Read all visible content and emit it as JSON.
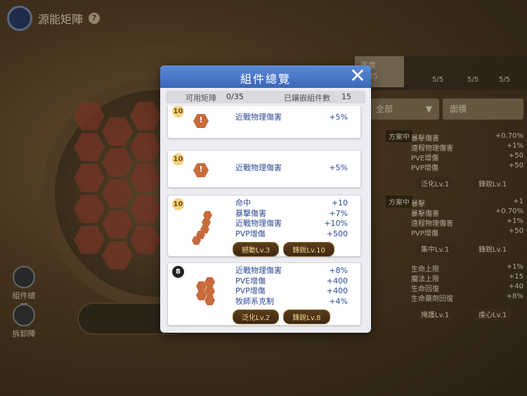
{
  "app": {
    "title": "源能矩陣",
    "help_icon": "question-icon",
    "side_buttons": [
      {
        "label": "組件總覽",
        "icon": "components-icon"
      },
      {
        "label": "拆卸陣",
        "icon": "dismantle-icon"
      }
    ]
  },
  "background_panel": {
    "progress_label": "進度",
    "progress_value": "5/35",
    "counts": [
      "5/5",
      "5/5",
      "5/5"
    ],
    "filter_left": "全部",
    "filter_right": "面積",
    "blocks": [
      {
        "plan_tag": "方案中",
        "stats": [
          {
            "label": "暴擊傷害",
            "value": "+0.70%"
          },
          {
            "label": "遠程物理傷害",
            "value": "+1%"
          },
          {
            "label": "PVE增傷",
            "value": "+50"
          },
          {
            "label": "PVP增傷",
            "value": "+50"
          }
        ],
        "skills": [
          "泛化Lv.1",
          "鋒銳Lv.1"
        ]
      },
      {
        "plan_tag": "方案中",
        "stats": [
          {
            "label": "暴擊",
            "value": "+1"
          },
          {
            "label": "暴擊傷害",
            "value": "+0.70%"
          },
          {
            "label": "遠程物理傷害",
            "value": "+1%"
          },
          {
            "label": "PVP增傷",
            "value": "+50"
          }
        ],
        "skills": [
          "集中Lv.1",
          "鋒銳Lv.1"
        ]
      },
      {
        "plan_tag": "",
        "stats": [
          {
            "label": "生命上限",
            "value": "+1%"
          },
          {
            "label": "魔法上限",
            "value": "+15"
          },
          {
            "label": "生命回復",
            "value": "+40"
          },
          {
            "label": "生命藥劑回復",
            "value": "+8%"
          }
        ],
        "skills": [
          "掩護Lv.1",
          "虔心Lv.1"
        ]
      }
    ]
  },
  "modal": {
    "title": "組件總覽",
    "close_icon": "close-icon",
    "available_label": "可用矩陣",
    "available_value": "0/35",
    "embedded_label": "已鑲嵌組件數",
    "embedded_value": "15",
    "cards": [
      {
        "level": "10",
        "stats": [
          {
            "label": "近戰物理傷害",
            "value": "+5%"
          }
        ],
        "skills": []
      },
      {
        "level": "10",
        "stats": [
          {
            "label": "近戰物理傷害",
            "value": "+5%"
          }
        ],
        "skills": []
      },
      {
        "level": "10",
        "stats": [
          {
            "label": "命中",
            "value": "+10"
          },
          {
            "label": "暴擊傷害",
            "value": "+7%"
          },
          {
            "label": "近戰物理傷害",
            "value": "+10%"
          },
          {
            "label": "PVP增傷",
            "value": "+500"
          }
        ],
        "skills": [
          "撼動Lv.3",
          "鋒銳Lv.10"
        ]
      },
      {
        "level": "8",
        "stats": [
          {
            "label": "近戰物理傷害",
            "value": "+8%"
          },
          {
            "label": "PVE增傷",
            "value": "+400"
          },
          {
            "label": "PVP增傷",
            "value": "+400"
          },
          {
            "label": "牧師系克制",
            "value": "+4%"
          }
        ],
        "skills": [
          "泛化Lv.2",
          "鋒銳Lv.8"
        ]
      }
    ]
  }
}
